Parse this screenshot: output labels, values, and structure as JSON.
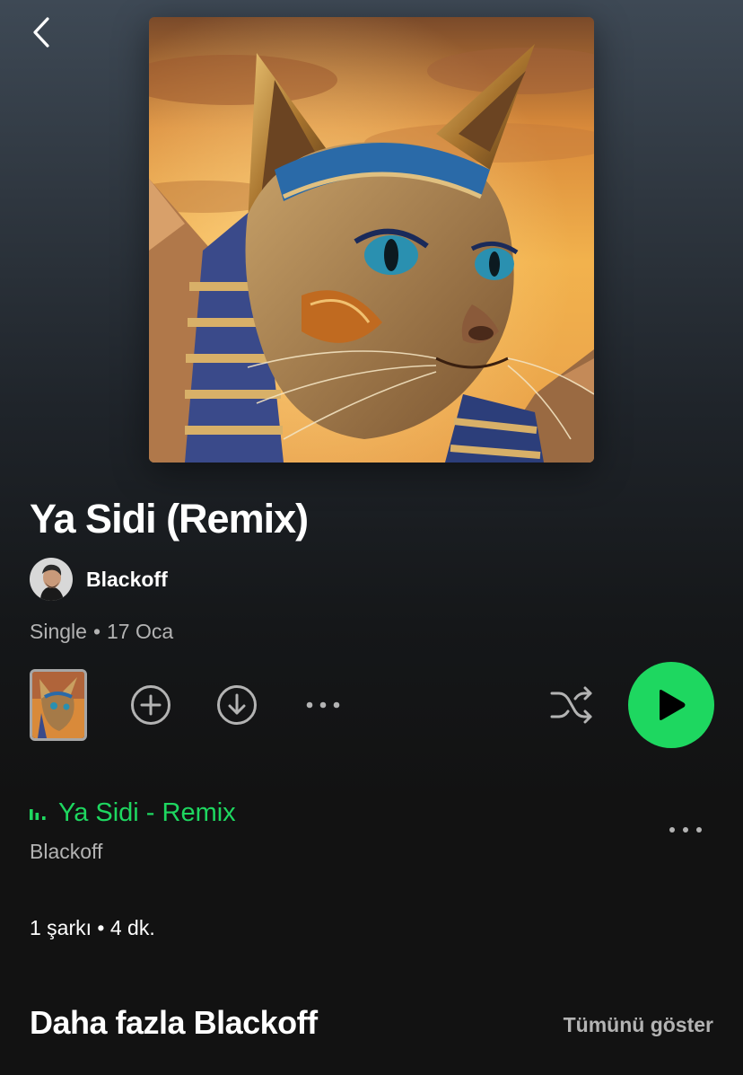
{
  "header": {
    "back_icon": "chevron-left-icon"
  },
  "album": {
    "cover_art": "album-cover-image",
    "title": "Ya Sidi (Remix)",
    "artist": "Blackoff",
    "type": "Single",
    "separator": "•",
    "release_date": "17 Oca"
  },
  "actions": {
    "thumbnail_icon": "album-thumbnail",
    "add_icon": "plus-circle-icon",
    "download_icon": "download-circle-icon",
    "more_icon": "more-horizontal-icon",
    "shuffle_icon": "shuffle-icon",
    "play_icon": "play-icon",
    "play_color": "#1ed760"
  },
  "tracks": [
    {
      "title": "Ya Sidi - Remix",
      "artist": "Blackoff",
      "playing": true,
      "accent_color": "#1ed760"
    }
  ],
  "summary": {
    "text": "1 şarkı • 4 dk."
  },
  "more_from": {
    "title": "Daha fazla Blackoff",
    "show_all_label": "Tümünü göster"
  }
}
